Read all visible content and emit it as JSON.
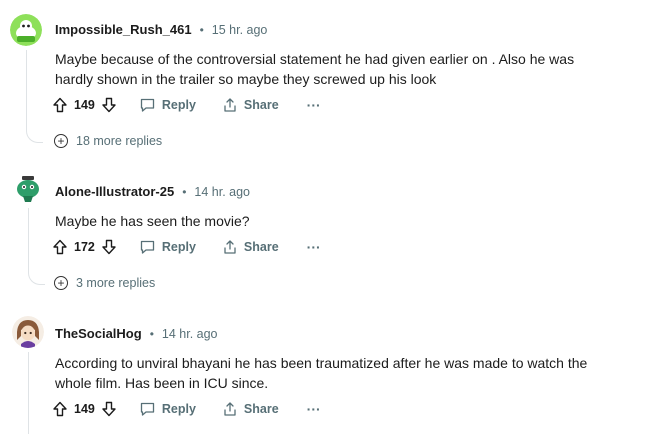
{
  "comments": [
    {
      "username": "Impossible_Rush_461",
      "separator": "•",
      "time": "15 hr. ago",
      "text": "Maybe because of the controversial statement he had given earlier on . Also he was hardly shown in the trailer so maybe they screwed up his look",
      "votes": "149",
      "reply_label": "Reply",
      "share_label": "Share",
      "more_label": "···",
      "more_replies": "18 more replies"
    },
    {
      "username": "Alone-Illustrator-25",
      "separator": "•",
      "time": "14 hr. ago",
      "text": "Maybe he has seen the movie?",
      "votes": "172",
      "reply_label": "Reply",
      "share_label": "Share",
      "more_label": "···",
      "more_replies": "3 more replies"
    },
    {
      "username": "TheSocialHog",
      "separator": "•",
      "time": "14 hr. ago",
      "text": "According to unviral bhayani he has been traumatized after he was made to watch the whole film. Has been in ICU since.",
      "votes": "149",
      "reply_label": "Reply",
      "share_label": "Share",
      "more_label": "···"
    }
  ],
  "icons": {
    "upvote": "upvote-icon",
    "downvote": "downvote-icon",
    "reply": "comment-bubble-icon",
    "share": "share-icon",
    "more": "overflow-menu-icon",
    "expand": "plus-circle-icon"
  },
  "colors": {
    "text_primary": "#1c1c1c",
    "text_secondary": "#576f76",
    "thread_line": "#dfe3e6",
    "avatar1_green": "#7bd84a",
    "avatar2_green": "#2e9e6a"
  }
}
